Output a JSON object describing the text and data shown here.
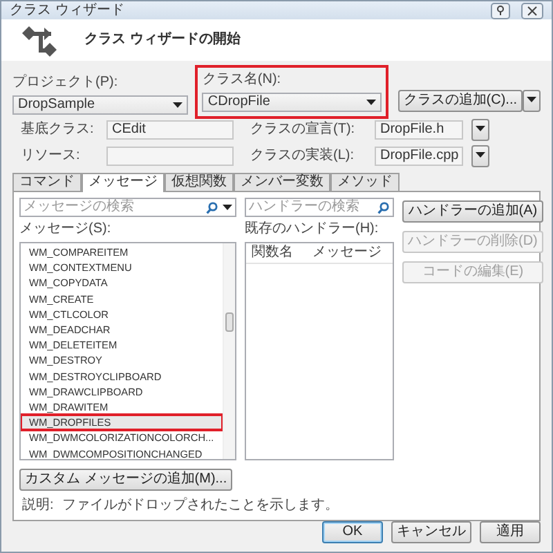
{
  "window": {
    "title": "クラス ウィザード"
  },
  "header": {
    "title": "クラス ウィザードの開始"
  },
  "project": {
    "label": "プロジェクト(P):",
    "value": "DropSample"
  },
  "class_name": {
    "label": "クラス名(N):",
    "value": "CDropFile",
    "highlighted": true
  },
  "add_class_button": "クラスの追加(C)...",
  "base_class": {
    "label": "基底クラス:",
    "value": "CEdit"
  },
  "class_header": {
    "label": "クラスの宣言(T):",
    "value": "DropFile.h"
  },
  "resource": {
    "label": "リソース:"
  },
  "class_impl": {
    "label": "クラスの実装(L):",
    "value": "DropFile.cpp"
  },
  "tabs": [
    {
      "label": "コマンド",
      "selected": false
    },
    {
      "label": "メッセージ",
      "selected": true
    },
    {
      "label": "仮想関数",
      "selected": false
    },
    {
      "label": "メンバー変数",
      "selected": false
    },
    {
      "label": "メソッド",
      "selected": false
    }
  ],
  "message_search": {
    "placeholder": "メッセージの検索"
  },
  "handler_search": {
    "placeholder": "ハンドラーの検索"
  },
  "messages_label": "メッセージ(S):",
  "messages": [
    {
      "label": "WM_COMPAREITEM",
      "selected": false
    },
    {
      "label": "WM_CONTEXTMENU",
      "selected": false
    },
    {
      "label": "WM_COPYDATA",
      "selected": false
    },
    {
      "label": "WM_CREATE",
      "selected": false
    },
    {
      "label": "WM_CTLCOLOR",
      "selected": false
    },
    {
      "label": "WM_DEADCHAR",
      "selected": false
    },
    {
      "label": "WM_DELETEITEM",
      "selected": false
    },
    {
      "label": "WM_DESTROY",
      "selected": false
    },
    {
      "label": "WM_DESTROYCLIPBOARD",
      "selected": false
    },
    {
      "label": "WM_DRAWCLIPBOARD",
      "selected": false
    },
    {
      "label": "WM_DRAWITEM",
      "selected": false
    },
    {
      "label": "WM_DROPFILES",
      "selected": true
    },
    {
      "label": "WM_DWMCOLORIZATIONCOLORCH...",
      "selected": false
    },
    {
      "label": "WM_DWMCOMPOSITIONCHANGED",
      "selected": false
    }
  ],
  "handlers_label": "既存のハンドラー(H):",
  "handler_columns": [
    "関数名",
    "メッセージ"
  ],
  "handler_buttons": [
    {
      "label": "ハンドラーの追加(A)",
      "disabled": false
    },
    {
      "label": "ハンドラーの削除(D)",
      "disabled": true
    },
    {
      "label": "コードの編集(E)",
      "disabled": true
    }
  ],
  "custom_message_button": "カスタム メッセージの追加(M)...",
  "description": {
    "label": "説明:",
    "text": "ファイルがドロップされたことを示します。"
  },
  "dialog_buttons": [
    {
      "label": "OK",
      "default": true
    },
    {
      "label": "キャンセル",
      "default": false
    },
    {
      "label": "適用",
      "default": false
    }
  ]
}
